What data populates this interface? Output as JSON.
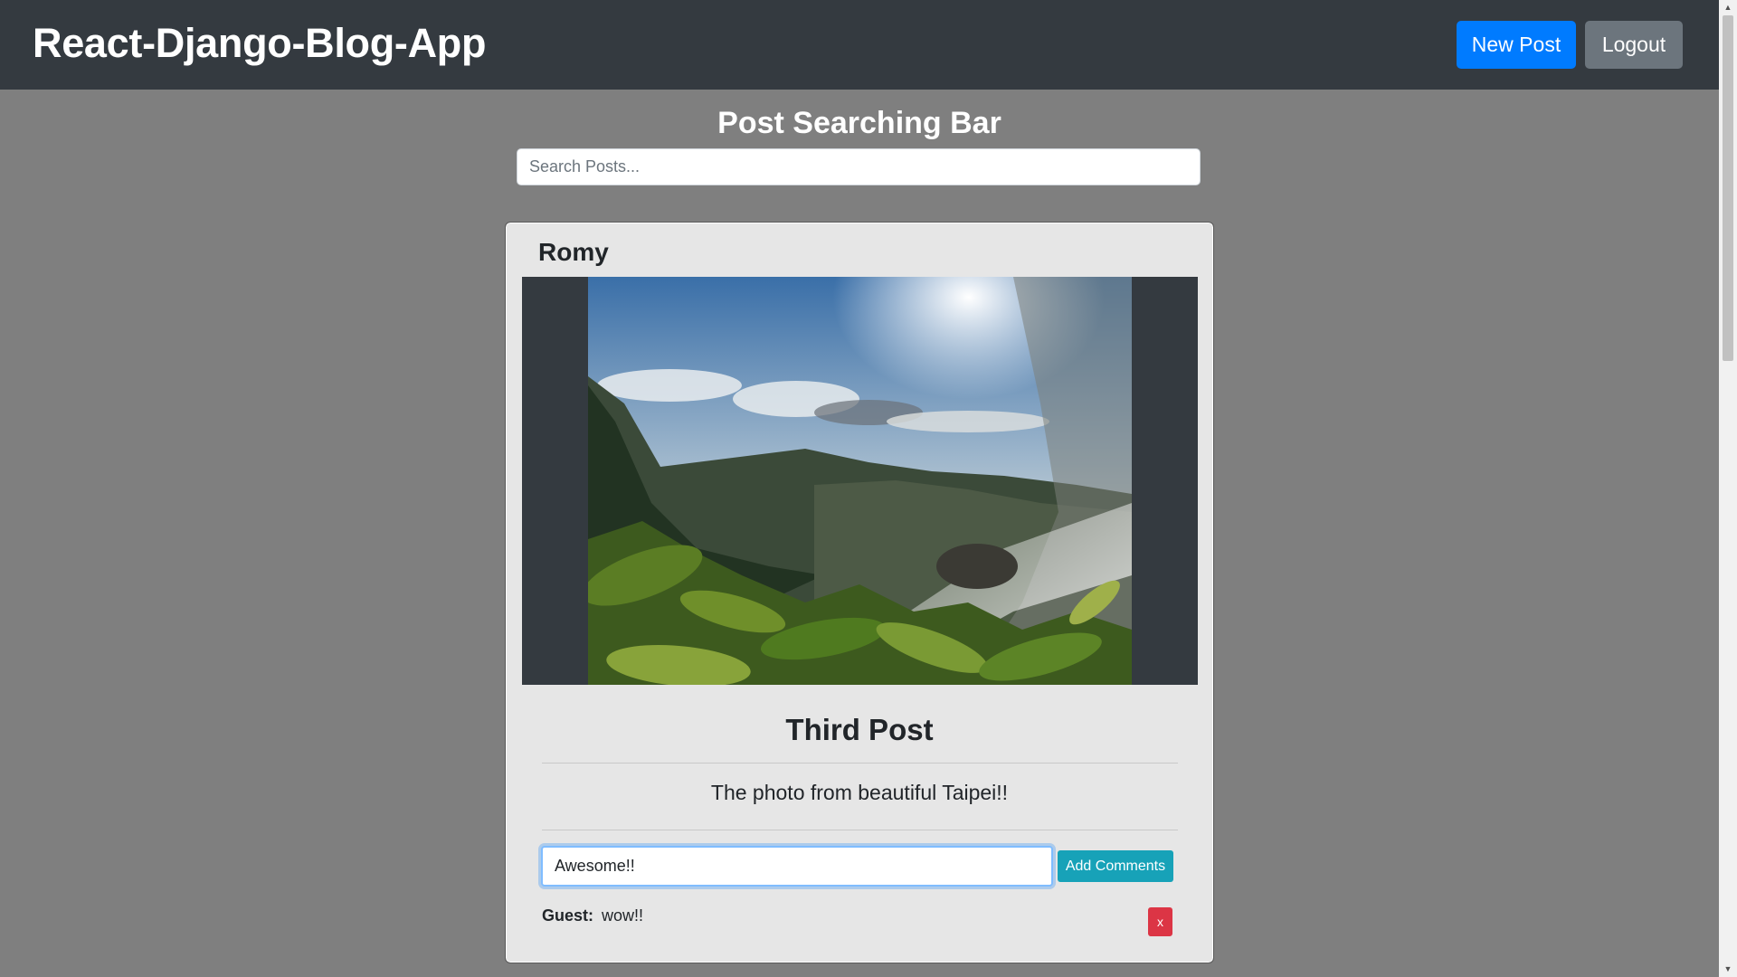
{
  "navbar": {
    "brand": "React-Django-Blog-App",
    "new_post_label": "New Post",
    "logout_label": "Logout"
  },
  "search": {
    "title": "Post Searching Bar",
    "placeholder": "Search Posts..."
  },
  "post": {
    "author": "Romy",
    "image_alt": "Mountain landscape with waterfall spray",
    "title": "Third Post",
    "body": "The photo from beautiful Taipei!!",
    "comment_input_value": "Awesome!!",
    "add_comment_label": "Add Comments",
    "comments": [
      {
        "author": "Guest:",
        "text": "wow!!",
        "delete_label": "x"
      }
    ]
  },
  "colors": {
    "navbar_bg": "#343a40",
    "page_bg": "#7f7f7f",
    "primary": "#007bff",
    "secondary": "#6c757d",
    "info": "#17a2b8",
    "danger": "#dc3545"
  },
  "scrollbar": {
    "up_icon": "chevron-up-icon",
    "down_icon": "chevron-down-icon"
  }
}
